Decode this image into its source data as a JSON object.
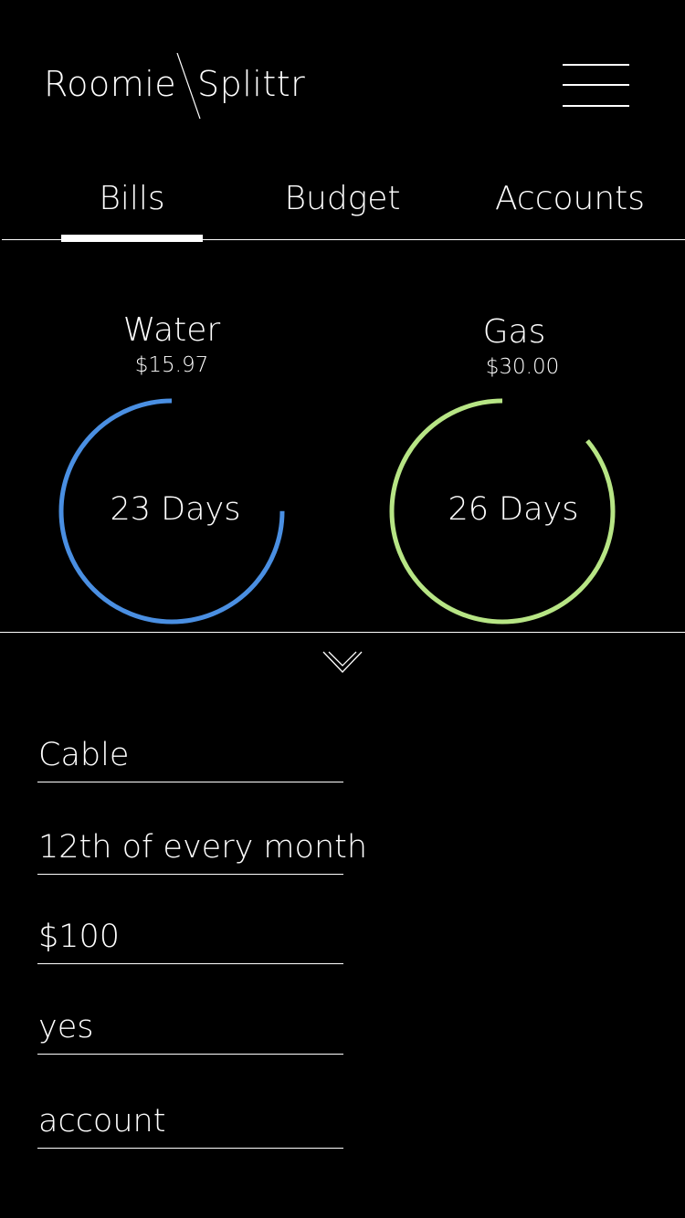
{
  "header": {
    "brand_left": "Roomie",
    "brand_right": "Splittr",
    "menu_icon": "hamburger-menu-icon"
  },
  "tabs": [
    {
      "label": "Bills",
      "active": true
    },
    {
      "label": "Budget",
      "active": false
    },
    {
      "label": "Accounts",
      "active": false
    }
  ],
  "bills": [
    {
      "name": "Water",
      "amount": "$15.97",
      "days_label": "23 Days",
      "progress": 0.75,
      "color": "#4A8FE2"
    },
    {
      "name": "Gas",
      "amount": "$30.00",
      "days_label": "26 Days",
      "progress": 0.86,
      "color": "#B7E585"
    }
  ],
  "expand_icon": "chevron-down-icon",
  "form": {
    "fields": [
      {
        "value": "Cable"
      },
      {
        "value": "12th of every month"
      },
      {
        "value": "$100"
      },
      {
        "value": "yes"
      },
      {
        "value": "account"
      }
    ]
  },
  "colors": {
    "background": "#000000",
    "text": "#FFFFFF",
    "water_gauge": "#4A8FE2",
    "gas_gauge": "#B7E585"
  }
}
